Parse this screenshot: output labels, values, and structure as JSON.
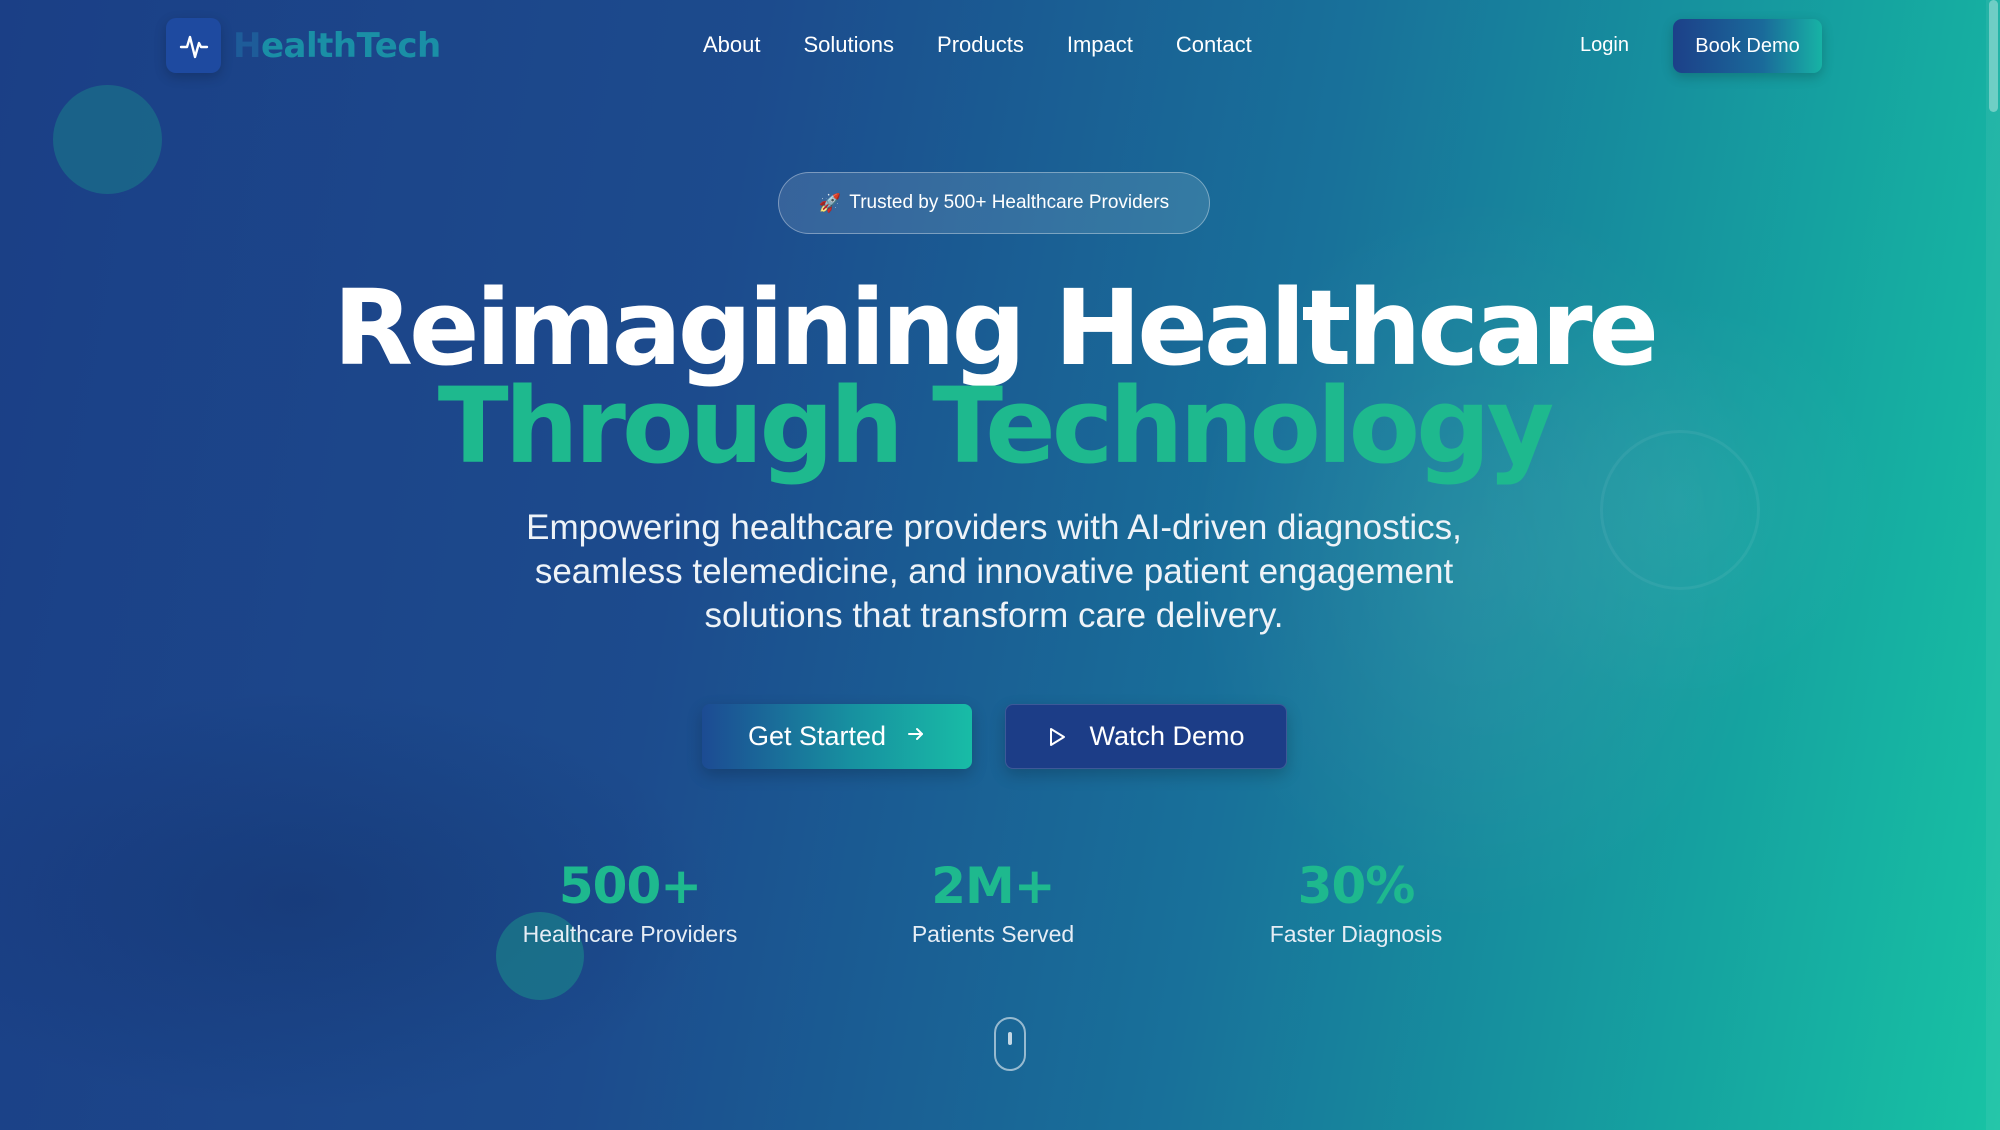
{
  "brand": {
    "name_fade": "H",
    "name_rest": "ealthTech",
    "logo_icon": "pulse-icon"
  },
  "nav": {
    "links": [
      "About",
      "Solutions",
      "Products",
      "Impact",
      "Contact"
    ],
    "login": "Login",
    "cta": "Book Demo"
  },
  "hero": {
    "badge": "Trusted by 500+ Healthcare Providers",
    "badge_icon": "rocket-icon",
    "title_line1": "Reimagining Healthcare",
    "title_line2": "Through Technology",
    "subtitle": "Empowering healthcare providers with AI-driven diagnostics, seamless telemedicine, and innovative patient engagement solutions that transform care delivery.",
    "primary_button": "Get Started",
    "secondary_button": "Watch Demo"
  },
  "stats": [
    {
      "value": "500+",
      "label": "Healthcare Providers"
    },
    {
      "value": "2M+",
      "label": "Patients Served"
    },
    {
      "value": "30%",
      "label": "Faster Diagnosis"
    }
  ],
  "colors": {
    "accent_green": "#1eb98e",
    "navy": "#1c3d87",
    "teal": "#18c3a4"
  }
}
